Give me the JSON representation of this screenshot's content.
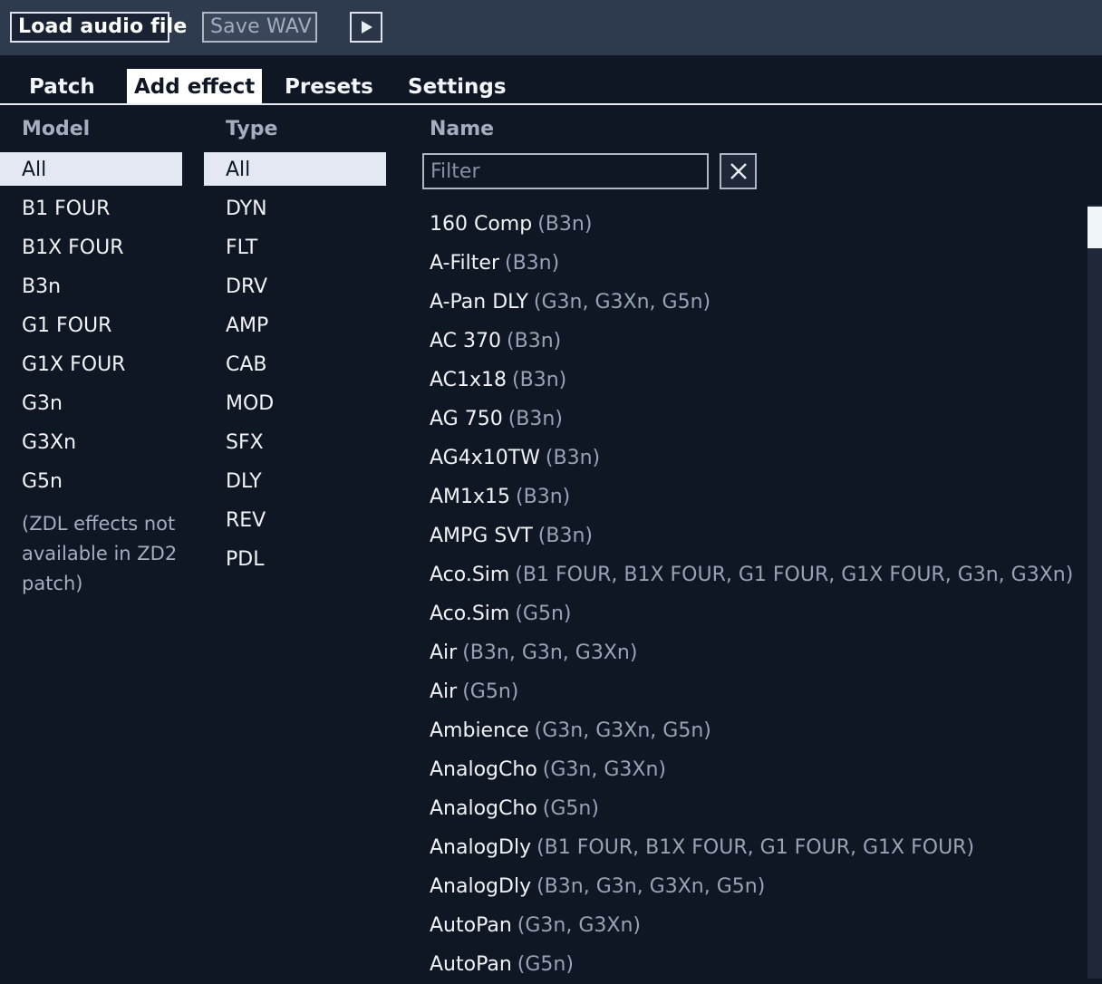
{
  "toolbar": {
    "load_label": "Load audio file",
    "save_label": "Save WAV",
    "play_icon": "play-icon"
  },
  "tabs": [
    {
      "label": "Patch",
      "active": false
    },
    {
      "label": "Add effect",
      "active": true
    },
    {
      "label": "Presets",
      "active": false
    },
    {
      "label": "Settings",
      "active": false
    }
  ],
  "columns": {
    "model_header": "Model",
    "type_header": "Type",
    "name_header": "Name"
  },
  "model_list": {
    "items": [
      "All",
      "B1 FOUR",
      "B1X FOUR",
      "B3n",
      "G1 FOUR",
      "G1X FOUR",
      "G3n",
      "G3Xn",
      "G5n"
    ],
    "selected": "All",
    "note": "(ZDL effects not available in ZD2 patch)"
  },
  "type_list": {
    "items": [
      "All",
      "DYN",
      "FLT",
      "DRV",
      "AMP",
      "CAB",
      "MOD",
      "SFX",
      "DLY",
      "REV",
      "PDL"
    ],
    "selected": "All"
  },
  "filter": {
    "placeholder": "Filter",
    "value": "",
    "clear_icon": "close-icon"
  },
  "effects": [
    {
      "name": "160 Comp",
      "models": "(B3n)"
    },
    {
      "name": "A-Filter",
      "models": "(B3n)"
    },
    {
      "name": "A-Pan DLY",
      "models": "(G3n, G3Xn, G5n)"
    },
    {
      "name": "AC 370",
      "models": "(B3n)"
    },
    {
      "name": "AC1x18",
      "models": "(B3n)"
    },
    {
      "name": "AG 750",
      "models": "(B3n)"
    },
    {
      "name": "AG4x10TW",
      "models": "(B3n)"
    },
    {
      "name": "AM1x15",
      "models": "(B3n)"
    },
    {
      "name": "AMPG SVT",
      "models": "(B3n)"
    },
    {
      "name": "Aco.Sim",
      "models": "(B1 FOUR, B1X FOUR, G1 FOUR, G1X FOUR, G3n, G3Xn)"
    },
    {
      "name": "Aco.Sim",
      "models": "(G5n)"
    },
    {
      "name": "Air",
      "models": "(B3n, G3n, G3Xn)"
    },
    {
      "name": "Air",
      "models": "(G5n)"
    },
    {
      "name": "Ambience",
      "models": "(G3n, G3Xn, G5n)"
    },
    {
      "name": "AnalogCho",
      "models": "(G3n, G3Xn)"
    },
    {
      "name": "AnalogCho",
      "models": "(G5n)"
    },
    {
      "name": "AnalogDly",
      "models": "(B1 FOUR, B1X FOUR, G1 FOUR, G1X FOUR)"
    },
    {
      "name": "AnalogDly",
      "models": "(B3n, G3n, G3Xn, G5n)"
    },
    {
      "name": "AutoPan",
      "models": "(G3n, G3Xn)"
    },
    {
      "name": "AutoPan",
      "models": "(G5n)"
    }
  ],
  "scrollbar": {
    "position": 0.0
  }
}
